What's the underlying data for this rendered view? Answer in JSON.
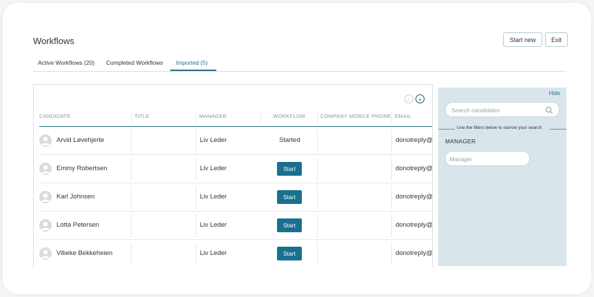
{
  "page": {
    "title": "Workflows"
  },
  "header": {
    "start_new_label": "Start new",
    "exit_label": "Exit"
  },
  "tabs": [
    {
      "label": "Active Workflows (20)"
    },
    {
      "label": "Completed Workflows"
    },
    {
      "label": "Imported (5)",
      "active": true
    }
  ],
  "table": {
    "columns": [
      "CANDIDATE",
      "TITLE",
      "MANAGER",
      "WORKFLOW",
      "COMPANY MOBILE PHONE",
      "EMAIL"
    ],
    "start_label": "Start",
    "rows": [
      {
        "candidate": "Arvid Løvehjerte",
        "title": "",
        "manager": "Liv Leder",
        "workflow": "Started",
        "phone": "",
        "email": "donotreply@e"
      },
      {
        "candidate": "Emmy Robertsen",
        "title": "",
        "manager": "Liv Leder",
        "workflow": "Start",
        "phone": "",
        "email": "donotreply@e"
      },
      {
        "candidate": "Karl Johnsen",
        "title": "",
        "manager": "Liv Leder",
        "workflow": "Start",
        "phone": "",
        "email": "donotreply@e"
      },
      {
        "candidate": "Lotta Petersen",
        "title": "",
        "manager": "Liv Leder",
        "workflow": "Start",
        "phone": "",
        "email": "donotreply@e"
      },
      {
        "candidate": "Vibeke Bekkeheien",
        "title": "",
        "manager": "Liv Leder",
        "workflow": "Start",
        "phone": "",
        "email": "donotreply@e"
      }
    ]
  },
  "filters": {
    "hide_label": "Hide",
    "search_placeholder": "Search candidates",
    "hint": "Use the filters below to narrow your search",
    "manager_label": "MANAGER",
    "manager_placeholder": "Manager"
  },
  "colors": {
    "accent": "#19708f",
    "panel_bg": "#d8e6ec",
    "tab_active": "#2a6f86"
  },
  "icons": {
    "search": "search-icon",
    "prev": "chevron-left-icon",
    "next": "chevron-right-icon",
    "avatar": "user-avatar-icon"
  }
}
